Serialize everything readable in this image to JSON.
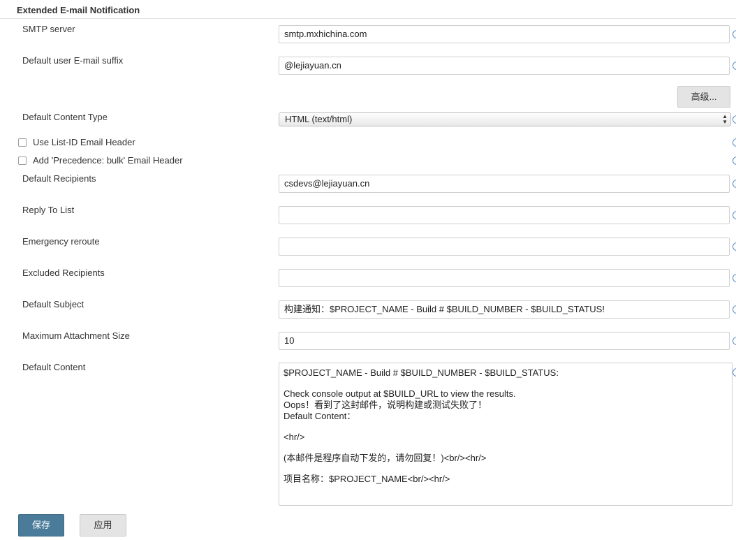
{
  "section": {
    "title": "Extended E-mail Notification"
  },
  "fields": {
    "smtp_server": {
      "label": "SMTP server",
      "value": "smtp.mxhichina.com"
    },
    "email_suffix": {
      "label": "Default user E-mail suffix",
      "value": "@lejiayuan.cn"
    },
    "advanced_label": "高级...",
    "content_type": {
      "label": "Default Content Type",
      "value": "HTML (text/html)"
    },
    "list_id": {
      "label": "Use List-ID Email Header"
    },
    "precedence": {
      "label": "Add 'Precedence: bulk' Email Header"
    },
    "recipients": {
      "label": "Default Recipients",
      "value": "csdevs@lejiayuan.cn"
    },
    "reply_to": {
      "label": "Reply To List",
      "value": ""
    },
    "emergency": {
      "label": "Emergency reroute",
      "value": ""
    },
    "excluded": {
      "label": "Excluded Recipients",
      "value": ""
    },
    "subject": {
      "label": "Default Subject",
      "value": "构建通知：$PROJECT_NAME - Build # $BUILD_NUMBER - $BUILD_STATUS!"
    },
    "attachment_size": {
      "label": "Maximum Attachment Size",
      "value": "10"
    },
    "content": {
      "label": "Default Content",
      "lines": [
        "$PROJECT_NAME - Build # $BUILD_NUMBER - $BUILD_STATUS:",
        "",
        "Check console output at $BUILD_URL to view the results.",
        "Oops！看到了这封邮件，说明构建或测试失败了！",
        "Default Content：",
        "",
        "<hr/>",
        "",
        "(本邮件是程序自动下发的，请勿回复！)<br/><hr/>",
        "",
        "项目名称：$PROJECT_NAME<br/><hr/>"
      ]
    }
  },
  "buttons": {
    "save": "保存",
    "apply": "应用"
  }
}
